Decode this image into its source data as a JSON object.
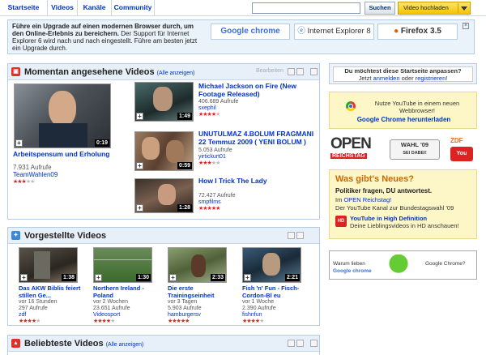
{
  "nav": {
    "tabs": [
      "Startseite",
      "Videos",
      "Kanäle",
      "Community"
    ],
    "search_value": "",
    "search_button": "Suchen",
    "upload_button": "Video hochladen"
  },
  "banner": {
    "line1": "Führe ein Upgrade auf einen modernen Browser durch, um den Online-Erlebnis zu bereichern.",
    "line2": "Der Support für Internet Explorer 6 wird nach und nach eingestellt. Führe am besten jetzt ein Upgrade durch.",
    "browsers": [
      "Google chrome",
      "Internet Explorer 8",
      "Firefox 3.5"
    ]
  },
  "watching": {
    "title": "Momentan angesehene Videos",
    "all_link": "(Alle anzeigen)",
    "edit_label": "Bearbeiten",
    "main": {
      "title": "Arbeitspensum und Erholung",
      "duration": "0:19",
      "views": "7.931 Aufrufe",
      "user": "TeamWahlen09",
      "rating": 3
    },
    "items": [
      {
        "title": "Michael Jackson on Fire (New Footage Released)",
        "duration": "1:49",
        "views": "406.689 Aufrufe",
        "user": "sxephil",
        "rating": 4
      },
      {
        "title": "UNUTULMAZ 4.BOLUM FRAGMANI 22 Temmuz 2009 ( YENI BOLUM )",
        "duration": "0:59",
        "views": "5.053 Aufrufe",
        "user": "yirtickurt01",
        "rating": 3
      },
      {
        "title": "How I Trick The Lady",
        "duration": "1:28",
        "views": "72.427 Aufrufe",
        "user": "smpfilms",
        "rating": 5
      }
    ]
  },
  "featured": {
    "title": "Vorgestellte Videos",
    "items": [
      {
        "title": "Das AKW Biblis feiert stillen Ge...",
        "duration": "1:38",
        "age": "vor 16 Stunden",
        "views": "297 Aufrufe",
        "user": "zdf",
        "rating": 4
      },
      {
        "title": "Northern Ireland - Poland",
        "duration": "1:30",
        "age": "vor 2 Wochen",
        "views": "23.651 Aufrufe",
        "user": "Videosport",
        "rating": 4
      },
      {
        "title": "Die erste Trainingseinheit",
        "duration": "2:33",
        "age": "vor 3 Tagen",
        "views": "5.903 Aufrufe",
        "user": "hamburgersv",
        "rating": 5
      },
      {
        "title": "Fish 'n' Fun - Fisch-Cordon-Bl eu",
        "duration": "2:21",
        "age": "vor 1 Woche",
        "views": "2.390 Aufrufe",
        "user": "fishnfun",
        "rating": 4
      }
    ]
  },
  "popular": {
    "title": "Beliebteste Videos",
    "all_link": "(Alle anzeigen)"
  },
  "right": {
    "personalize_q": "Du möchtest diese Startseite anpassen?",
    "personalize_now": "Jetzt",
    "personalize_login": "anmelden",
    "personalize_or": "oder",
    "personalize_register": "registrieren!",
    "chrome_text": "Nutze YouTube in einem neuen Webbrowser!",
    "chrome_link": "Google Chrome herunterladen",
    "open_word": "OPEN",
    "reichstag_word": "REICHSTAG",
    "wahl_line1": "WAHL '09",
    "wahl_line2": "SEI DABEI!",
    "zdf_word": "ZDF",
    "news_title": "Was gibt's Neues?",
    "news_head": "Politiker fragen, DU antwortest.",
    "news_line1_pre": "Im",
    "news_line1_link": "OPEN Reichstag!",
    "news_line2": "Der YouTube Kanal zur Bundestagswahl '09",
    "hd_link": "YouTube in High Definition",
    "hd_text": "Deine Lieblingsvideos in HD anschauen!",
    "ad_text1": "Warum lieben",
    "ad_text2": "Google Chrome?"
  }
}
